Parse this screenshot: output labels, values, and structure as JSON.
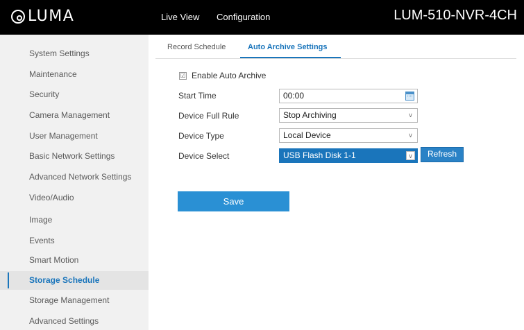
{
  "header": {
    "logo_text": "LUMA",
    "nav": {
      "live_view": "Live View",
      "configuration": "Configuration"
    },
    "device_name": "LUM-510-NVR-4CH"
  },
  "sidebar": {
    "active_item": "Storage Schedule",
    "items": [
      {
        "label": "System Settings"
      },
      {
        "label": "Maintenance"
      },
      {
        "label": "Security"
      },
      {
        "label": "Camera Management"
      },
      {
        "label": "User Management"
      },
      {
        "label": "Basic Network Settings"
      },
      {
        "label": "Advanced Network Settings"
      },
      {
        "label": "Video/Audio"
      },
      {
        "label": "Image"
      },
      {
        "label": "Events"
      },
      {
        "label": "Smart Motion"
      },
      {
        "label": "Storage Schedule"
      },
      {
        "label": "Storage Management"
      },
      {
        "label": "Advanced Settings"
      }
    ]
  },
  "tabs": {
    "active": "Auto Archive Settings",
    "items": [
      {
        "label": "Record Schedule"
      },
      {
        "label": "Auto Archive Settings"
      }
    ]
  },
  "form": {
    "enable_auto_archive": {
      "label": "Enable Auto Archive",
      "checked": true,
      "check_glyph": "☑"
    },
    "start_time": {
      "label": "Start Time",
      "value": "00:00"
    },
    "device_full_rule": {
      "label": "Device Full Rule",
      "value": "Stop Archiving"
    },
    "device_type": {
      "label": "Device Type",
      "value": "Local Device"
    },
    "device_select": {
      "label": "Device Select",
      "value": "USB Flash Disk 1-1"
    },
    "refresh_label": "Refresh",
    "save_label": "Save"
  },
  "colors": {
    "accent": "#1a75bb",
    "header_bg": "#000000",
    "sidebar_bg": "#f1f1f1",
    "button_bg": "#2a90d4"
  }
}
